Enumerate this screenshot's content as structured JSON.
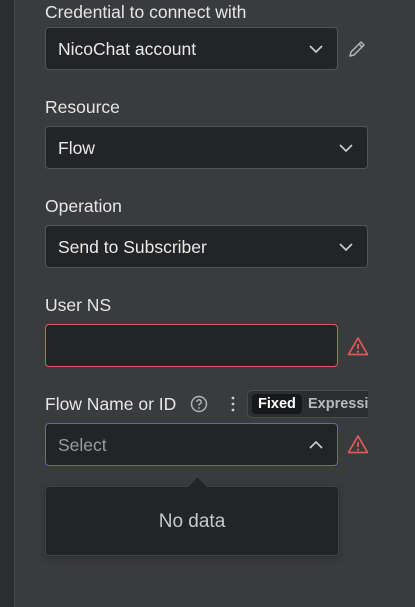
{
  "credential": {
    "label": "Credential to connect with",
    "value": "NicoChat account",
    "edit_icon": "pencil-icon"
  },
  "resource": {
    "label": "Resource",
    "value": "Flow"
  },
  "operation": {
    "label": "Operation",
    "value": "Send to Subscriber"
  },
  "user_ns": {
    "label": "User NS",
    "value": "",
    "error_icon": "warning-triangle-icon"
  },
  "flow": {
    "label": "Flow Name or ID",
    "help_icon": "question-circle-icon",
    "menu_icon": "kebab-menu-icon",
    "mode_fixed": "Fixed",
    "mode_expression": "Expressi",
    "placeholder": "Select",
    "empty_text": "No data",
    "error_icon": "warning-triangle-icon"
  },
  "colors": {
    "error": "#e05a5a",
    "focus": "#6b5bd6"
  }
}
